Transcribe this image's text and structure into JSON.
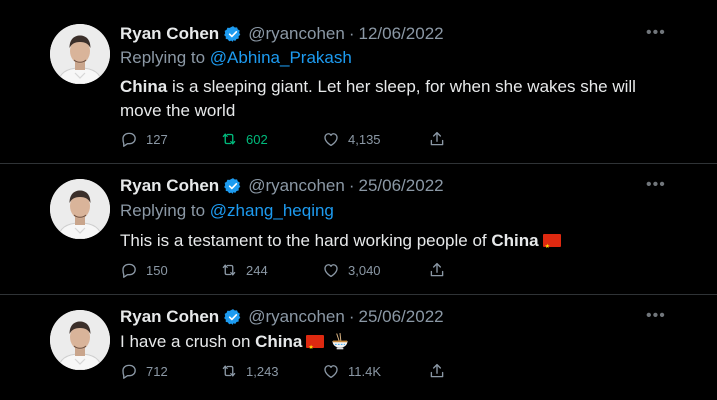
{
  "colors": {
    "background": "#000000",
    "text": "#e7e9ea",
    "muted": "#8b98a5",
    "link": "#1d9bf0",
    "retweet_active": "#00ba7c",
    "verified": "#1d9bf0"
  },
  "icons": [
    "verified-badge-icon",
    "more-icon",
    "reply-icon",
    "retweet-icon",
    "like-icon",
    "share-icon",
    "china-flag-emoji",
    "noodle-bowl-emoji"
  ],
  "tweets": [
    {
      "name": "Ryan Cohen",
      "handle": "@ryancohen",
      "separator": "·",
      "date": "12/06/2022",
      "replying_to_label": "Replying to",
      "replying_to": "@Abhina_Prakash",
      "text_bold": "China",
      "text_rest": " is a sleeping giant. Let her sleep, for when she wakes she will move the world",
      "replies": "127",
      "retweets": "602",
      "likes": "4,135"
    },
    {
      "name": "Ryan Cohen",
      "handle": "@ryancohen",
      "separator": "·",
      "date": "25/06/2022",
      "replying_to_label": "Replying to",
      "replying_to": "@zhang_heqing",
      "text_pre": "This is a testament to the hard working people of ",
      "text_bold": "China",
      "replies": "150",
      "retweets": "244",
      "likes": "3,040"
    },
    {
      "name": "Ryan Cohen",
      "handle": "@ryancohen",
      "separator": "·",
      "date": "25/06/2022",
      "text_pre": "I have a crush on ",
      "text_bold": "China",
      "replies": "712",
      "retweets": "1,243",
      "likes": "11.4K"
    }
  ]
}
